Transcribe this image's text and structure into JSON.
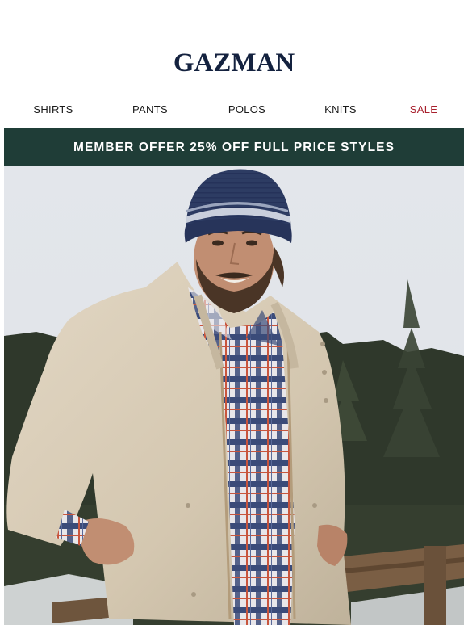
{
  "brand": {
    "name": "GAZMAN"
  },
  "nav": {
    "items": [
      {
        "label": "SHIRTS"
      },
      {
        "label": "PANTS"
      },
      {
        "label": "POLOS"
      },
      {
        "label": "KNITS"
      },
      {
        "label": "SALE"
      }
    ]
  },
  "banner": {
    "text": "MEMBER OFFER 25% OFF FULL PRICE STYLES"
  },
  "hero": {
    "image_icon": "man-in-beanie-and-jacket-photo",
    "colors": {
      "sky": "#e6e9ee",
      "forest": "#2c3528",
      "jacket": "#d9cdb8",
      "beanie": "#2d3c63"
    }
  }
}
